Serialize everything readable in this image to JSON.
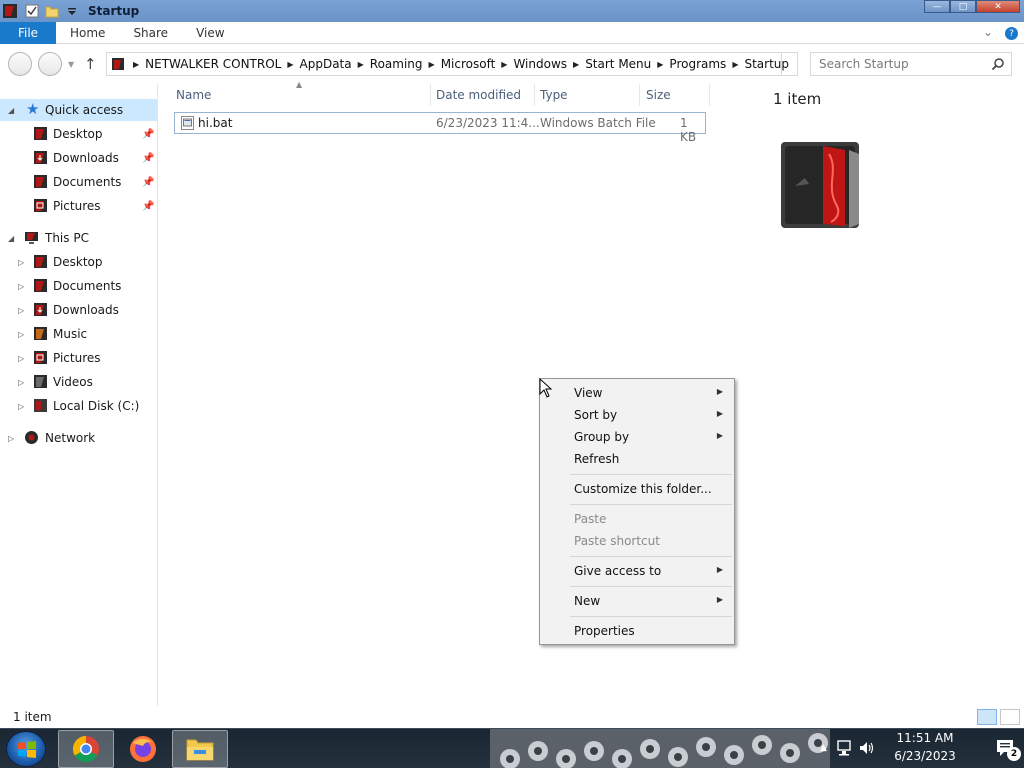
{
  "window": {
    "title": "Startup",
    "controls": {
      "minimize": "—",
      "maximize": "□",
      "close": "✕"
    }
  },
  "ribbon": {
    "tabs": [
      "File",
      "Home",
      "Share",
      "View"
    ],
    "expand_icon": "chevron-down-icon",
    "help_icon": "help-icon"
  },
  "address": {
    "crumbs": [
      "NETWALKER CONTROL",
      "AppData",
      "Roaming",
      "Microsoft",
      "Windows",
      "Start Menu",
      "Programs",
      "Startup"
    ]
  },
  "search": {
    "placeholder": "Search Startup"
  },
  "nav": {
    "quick_access": "Quick access",
    "quick_items": [
      "Desktop",
      "Downloads",
      "Documents",
      "Pictures"
    ],
    "this_pc": "This PC",
    "pc_items": [
      "Desktop",
      "Documents",
      "Downloads",
      "Music",
      "Pictures",
      "Videos",
      "Local Disk (C:)"
    ],
    "network": "Network"
  },
  "columns": {
    "name": "Name",
    "date": "Date modified",
    "type": "Type",
    "size": "Size"
  },
  "files": [
    {
      "name": "hi.bat",
      "date": "6/23/2023 11:4...",
      "type": "Windows Batch File",
      "size": "1 KB"
    }
  ],
  "preview": {
    "count": "1 item"
  },
  "context_menu": {
    "view": "View",
    "sort_by": "Sort by",
    "group_by": "Group by",
    "refresh": "Refresh",
    "customize": "Customize this folder...",
    "paste": "Paste",
    "paste_shortcut": "Paste shortcut",
    "give_access": "Give access to",
    "new": "New",
    "properties": "Properties"
  },
  "status": {
    "count": "1 item"
  },
  "taskbar": {
    "time": "11:51 AM",
    "date": "6/23/2023",
    "notification_count": "2"
  }
}
